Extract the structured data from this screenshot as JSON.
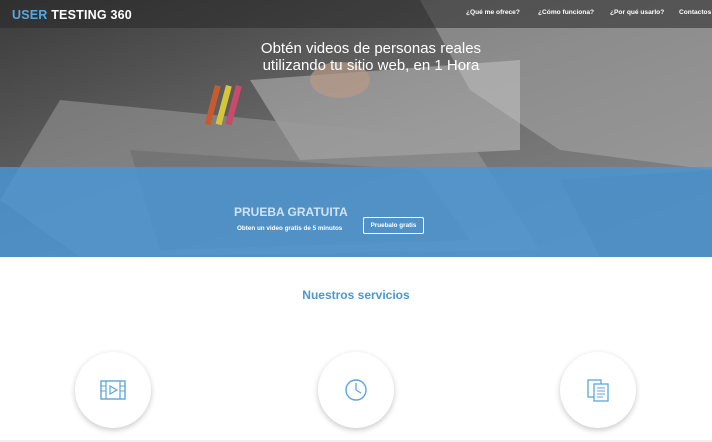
{
  "brand": {
    "part1": "USER",
    "part2": "TESTING 360",
    "accent_color": "#5aa6de"
  },
  "nav": {
    "items": [
      {
        "label": "¿Qué me ofrece?"
      },
      {
        "label": "¿Cómo funciona?"
      },
      {
        "label": "¿Por qué usarlo?"
      },
      {
        "label": "Contactos"
      }
    ]
  },
  "hero": {
    "headline_line1": "Obtén videos de personas reales",
    "headline_line2": "utilizando tu sitio web, en 1 Hora"
  },
  "promo": {
    "title": "PRUEBA GRATUITA",
    "subtitle": "Obten un video gratis de 5 minutos",
    "button_label": "Pruebalo gratis",
    "band_color": "#4896d6"
  },
  "services": {
    "title": "Nuestros servicios",
    "title_color": "#4a98d2",
    "items": [
      {
        "icon": "video-icon"
      },
      {
        "icon": "clock-icon"
      },
      {
        "icon": "documents-icon"
      }
    ]
  }
}
